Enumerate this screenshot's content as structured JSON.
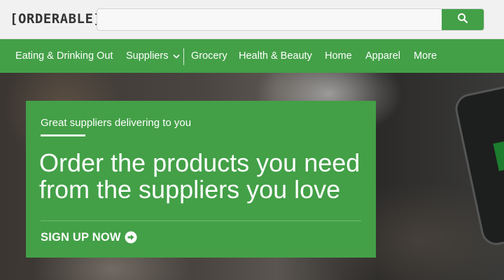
{
  "header": {
    "logo_text": "[ORDERABLE]",
    "search": {
      "placeholder": "",
      "value": "",
      "button_icon": "search-icon"
    }
  },
  "nav": {
    "items": [
      {
        "label": "Eating & Drinking Out"
      },
      {
        "label": "Suppliers",
        "has_dropdown": true
      },
      {
        "label": "Grocery"
      },
      {
        "label": "Health & Beauty"
      },
      {
        "label": "Home"
      },
      {
        "label": "Apparel"
      },
      {
        "label": "More"
      }
    ]
  },
  "hero": {
    "eyebrow": "Great suppliers delivering to you",
    "headline": "Order the products you need from the suppliers you love",
    "cta_label": "SIGN UP NOW",
    "cta_icon": "arrow-circle-icon"
  },
  "colors": {
    "brand_green": "#43a047",
    "topbar_bg": "#f1f1f1",
    "text_on_green": "#ffffff"
  }
}
